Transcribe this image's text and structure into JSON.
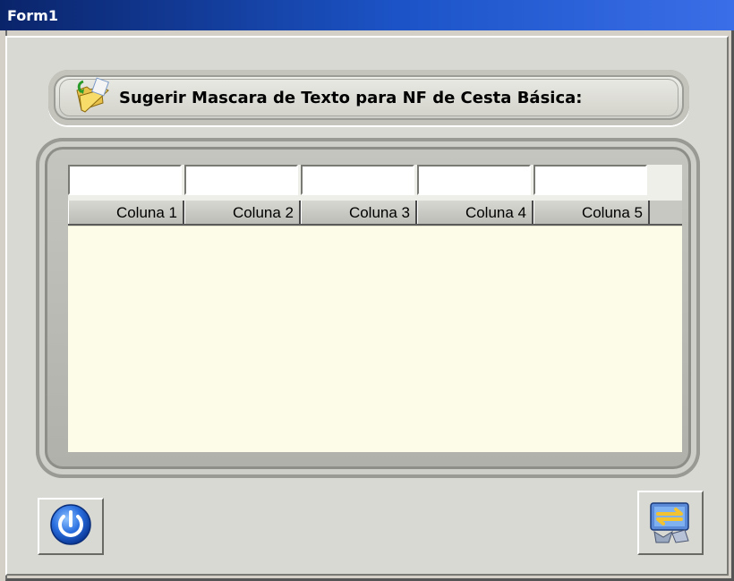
{
  "window": {
    "title": "Form1"
  },
  "header": {
    "title": "Sugerir Mascara de Texto para NF de Cesta Básica:",
    "icon": "folder-open-icon"
  },
  "grid": {
    "filters": [
      "",
      "",
      "",
      "",
      ""
    ],
    "columns": [
      "Coluna 1",
      "Coluna 2",
      "Coluna 3",
      "Coluna 4",
      "Coluna 5"
    ],
    "rows": []
  },
  "buttons": {
    "power_icon": "power-icon",
    "transfer_icon": "monitor-transfer-icon"
  },
  "colors": {
    "titlebar_start": "#0a246a",
    "titlebar_end": "#3a6ee8",
    "grid_background": "#fdfce8",
    "form_background": "#d9d9d3"
  }
}
